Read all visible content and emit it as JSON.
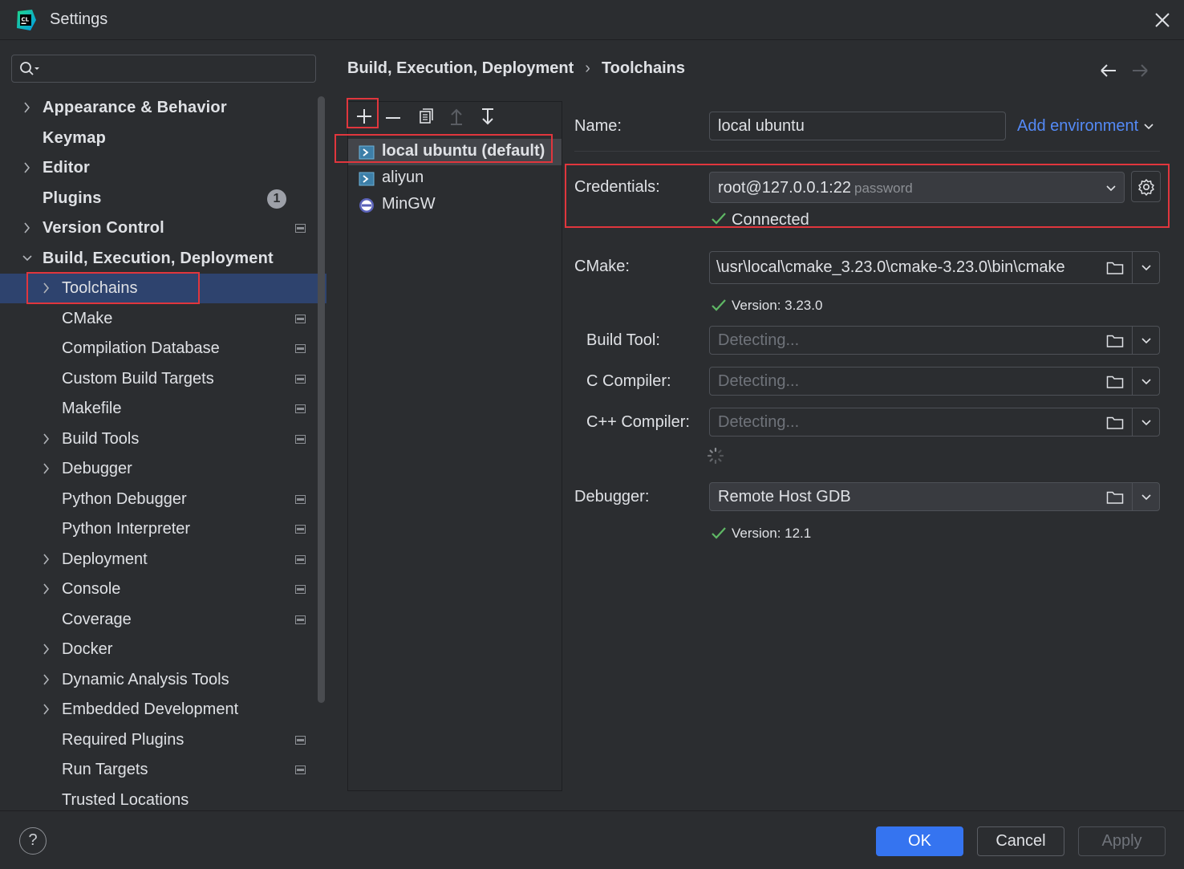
{
  "window": {
    "title": "Settings",
    "icon": "clion-icon"
  },
  "search": {
    "value": ""
  },
  "tree": [
    {
      "label": "Appearance & Behavior",
      "level": 0,
      "expandable": true,
      "bold": true,
      "project": false
    },
    {
      "label": "Keymap",
      "level": 0,
      "expandable": false,
      "bold": true,
      "project": false
    },
    {
      "label": "Editor",
      "level": 0,
      "expandable": true,
      "bold": true,
      "project": false
    },
    {
      "label": "Plugins",
      "level": 0,
      "expandable": false,
      "bold": true,
      "project": false,
      "badge": "1"
    },
    {
      "label": "Version Control",
      "level": 0,
      "expandable": true,
      "bold": true,
      "project": true
    },
    {
      "label": "Build, Execution, Deployment",
      "level": 0,
      "expandable": true,
      "expanded": true,
      "bold": true,
      "project": false
    },
    {
      "label": "Toolchains",
      "level": 1,
      "expandable": true,
      "bold": false,
      "project": false,
      "selected": true
    },
    {
      "label": "CMake",
      "level": 1,
      "expandable": false,
      "bold": false,
      "project": true
    },
    {
      "label": "Compilation Database",
      "level": 1,
      "expandable": false,
      "bold": false,
      "project": true
    },
    {
      "label": "Custom Build Targets",
      "level": 1,
      "expandable": false,
      "bold": false,
      "project": true
    },
    {
      "label": "Makefile",
      "level": 1,
      "expandable": false,
      "bold": false,
      "project": true
    },
    {
      "label": "Build Tools",
      "level": 1,
      "expandable": true,
      "bold": false,
      "project": true
    },
    {
      "label": "Debugger",
      "level": 1,
      "expandable": true,
      "bold": false,
      "project": false
    },
    {
      "label": "Python Debugger",
      "level": 1,
      "expandable": false,
      "bold": false,
      "project": true
    },
    {
      "label": "Python Interpreter",
      "level": 1,
      "expandable": false,
      "bold": false,
      "project": true
    },
    {
      "label": "Deployment",
      "level": 1,
      "expandable": true,
      "bold": false,
      "project": true
    },
    {
      "label": "Console",
      "level": 1,
      "expandable": true,
      "bold": false,
      "project": true
    },
    {
      "label": "Coverage",
      "level": 1,
      "expandable": false,
      "bold": false,
      "project": true
    },
    {
      "label": "Docker",
      "level": 1,
      "expandable": true,
      "bold": false,
      "project": false
    },
    {
      "label": "Dynamic Analysis Tools",
      "level": 1,
      "expandable": true,
      "bold": false,
      "project": false
    },
    {
      "label": "Embedded Development",
      "level": 1,
      "expandable": true,
      "bold": false,
      "project": false
    },
    {
      "label": "Required Plugins",
      "level": 1,
      "expandable": false,
      "bold": false,
      "project": true
    },
    {
      "label": "Run Targets",
      "level": 1,
      "expandable": false,
      "bold": false,
      "project": true
    },
    {
      "label": "Trusted Locations",
      "level": 1,
      "expandable": false,
      "bold": false,
      "project": false
    }
  ],
  "breadcrumb": {
    "parent": "Build, Execution, Deployment",
    "separator": "›",
    "current": "Toolchains"
  },
  "toolchains": [
    {
      "label": "local ubuntu (default)",
      "icon": "remote-host-icon",
      "selected": true
    },
    {
      "label": "aliyun",
      "icon": "remote-host-icon",
      "selected": false
    },
    {
      "label": "MinGW",
      "icon": "gnu-icon",
      "selected": false
    }
  ],
  "form": {
    "name_label": "Name:",
    "name_value": "local ubuntu",
    "add_env_label": "Add environment",
    "credentials_label": "Credentials:",
    "credentials_value": "root@127.0.0.1:22",
    "credentials_auth": "password",
    "connected_text": "Connected",
    "cmake_label": "CMake:",
    "cmake_value": "\\usr\\local\\cmake_3.23.0\\cmake-3.23.0\\bin\\cmake",
    "cmake_version": "Version: 3.23.0",
    "build_tool_label": "Build Tool:",
    "build_tool_placeholder": "Detecting...",
    "c_compiler_label": "C Compiler:",
    "c_compiler_placeholder": "Detecting...",
    "cpp_compiler_label": "C++ Compiler:",
    "cpp_compiler_placeholder": "Detecting...",
    "debugger_label": "Debugger:",
    "debugger_value": "Remote Host GDB",
    "debugger_version": "Version: 12.1"
  },
  "footer": {
    "help": "?",
    "ok": "OK",
    "cancel": "Cancel",
    "apply": "Apply"
  },
  "colors": {
    "accent": "#3574f0",
    "link": "#548af7",
    "success": "#5fb865",
    "highlight": "#e0363d",
    "selection": "#2e436e"
  }
}
